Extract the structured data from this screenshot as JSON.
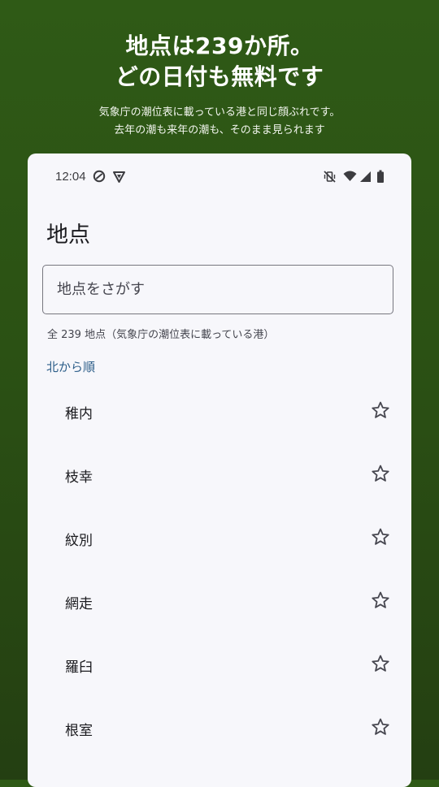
{
  "promo": {
    "headline_line1": "地点は239か所。",
    "headline_line2": "どの日付も無料です",
    "sub_line1": "気象庁の潮位表に載っている港と同じ顔ぶれです。",
    "sub_line2": "去年の潮も来年の潮も、そのまま見られます"
  },
  "status_bar": {
    "time": "12:04",
    "icons": [
      "do-not-disturb-icon",
      "vpn-shield-icon",
      "vibrate-off-icon",
      "wifi-icon",
      "cellular-signal-icon",
      "battery-icon"
    ]
  },
  "app": {
    "title": "地点",
    "search_placeholder": "地点をさがす",
    "search_value": "",
    "count_text": "全 239 地点（気象庁の潮位表に載っている港）",
    "sort_label": "北から順",
    "ports": [
      {
        "name": "稚内",
        "favorite": false
      },
      {
        "name": "枝幸",
        "favorite": false
      },
      {
        "name": "紋別",
        "favorite": false
      },
      {
        "name": "網走",
        "favorite": false
      },
      {
        "name": "羅臼",
        "favorite": false
      },
      {
        "name": "根室",
        "favorite": false
      }
    ]
  },
  "colors": {
    "background_green": "#2f5a16",
    "card_background": "#f7f7fb",
    "link_blue": "#2e5f8a",
    "text_dark": "#1b1b1f"
  }
}
